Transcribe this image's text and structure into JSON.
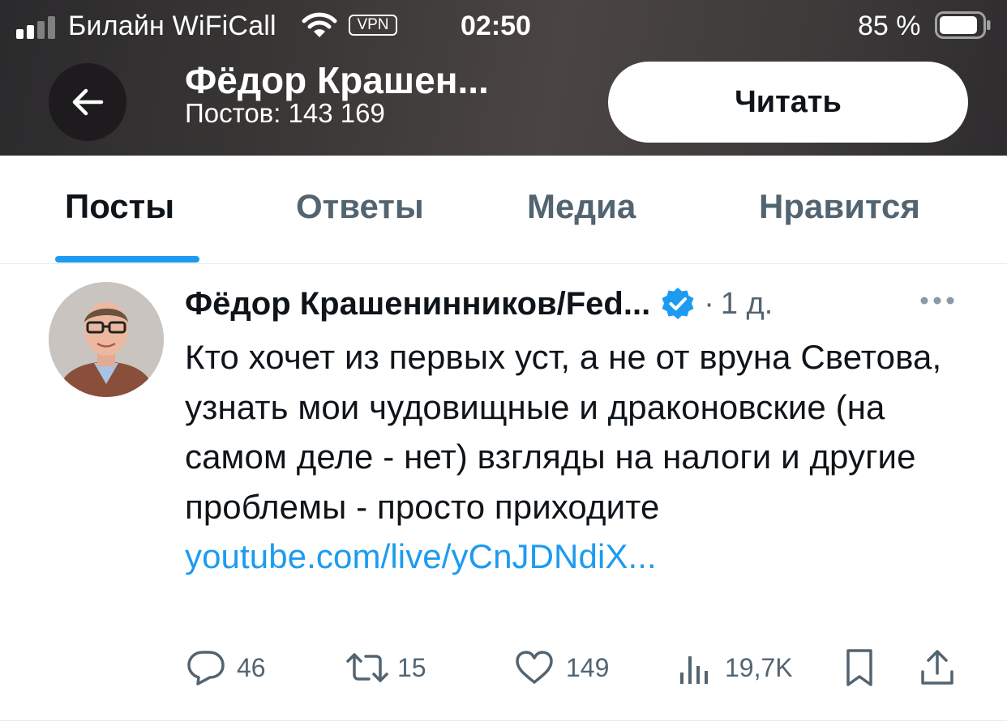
{
  "status_bar": {
    "carrier": "Билайн WiFiCall",
    "vpn": "VPN",
    "time": "02:50",
    "battery_percent": "85 %"
  },
  "header": {
    "name": "Фёдор Крашен...",
    "posts": "Постов: 143 169",
    "follow_label": "Читать"
  },
  "tabs": [
    {
      "label": "Посты",
      "active": true
    },
    {
      "label": "Ответы",
      "active": false
    },
    {
      "label": "Медиа",
      "active": false
    },
    {
      "label": "Нравится",
      "active": false
    }
  ],
  "tweet": {
    "author": "Фёдор Крашенинников/Fed...",
    "dot": "·",
    "age": "1 д.",
    "text": "Кто хочет из первых уст, а не от вруна Светова, узнать мои чудовищные и драконовские (на самом деле - нет) взгляды на налоги и другие проблемы - просто приходите ",
    "link": "youtube.com/live/yCnJDNdiX...",
    "replies": "46",
    "reposts": "15",
    "likes": "149",
    "views": "19,7K"
  },
  "colors": {
    "accent": "#1d9bf0",
    "secondary_text": "#536471",
    "primary_text": "#0f1419"
  },
  "icons": [
    "back-arrow-icon",
    "wifi-icon",
    "battery-icon",
    "verified-badge-icon",
    "more-icon",
    "reply-icon",
    "repost-icon",
    "like-icon",
    "views-icon",
    "bookmark-icon",
    "share-icon"
  ]
}
